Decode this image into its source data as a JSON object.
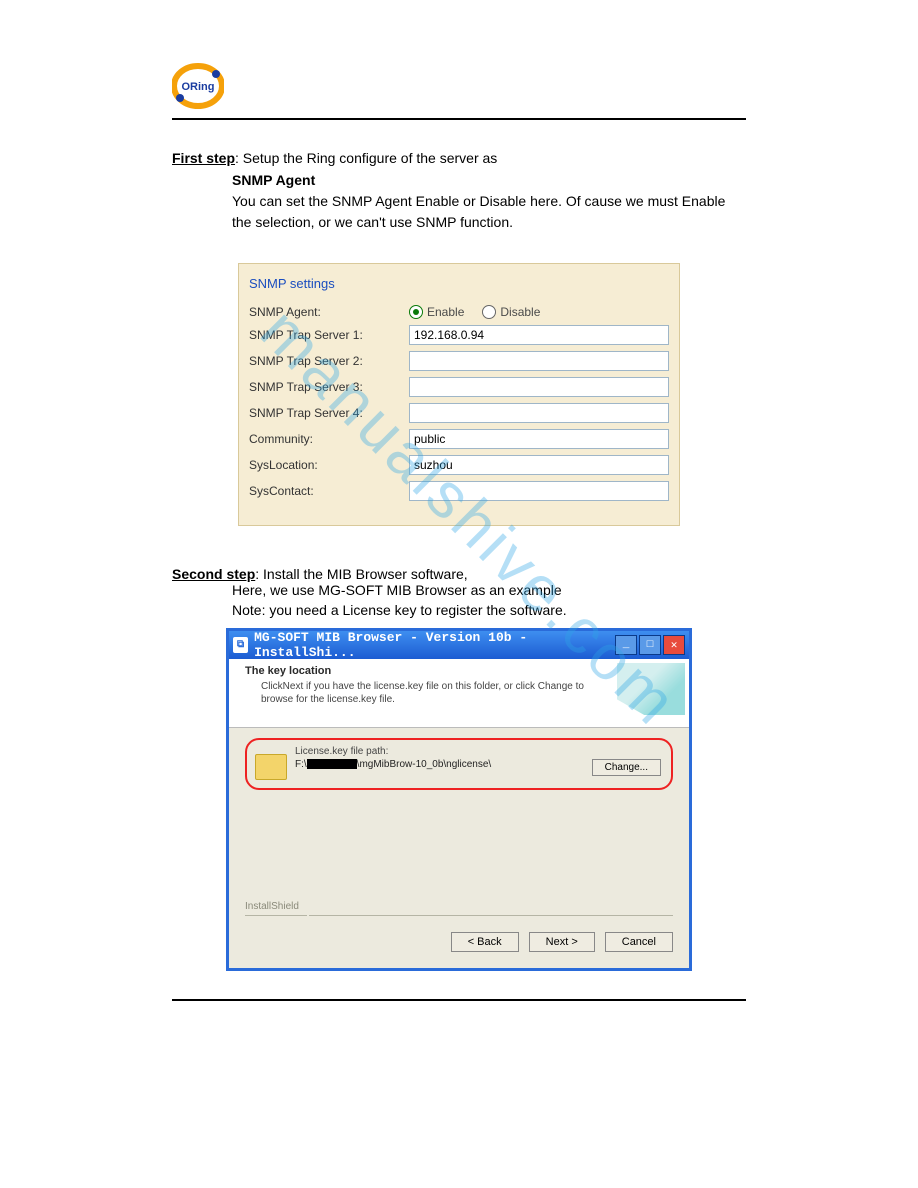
{
  "watermark": "manualshive.com",
  "step1": {
    "prefix_underlined": "First step",
    "rest": ": Setup the Ring configure of the server as",
    "body1": "SNMP Agent",
    "body2": "You can set the SNMP Agent Enable or Disable here. Of cause we must Enable the selection, or we can't use SNMP function."
  },
  "snmp": {
    "title": "SNMP settings",
    "labels": {
      "agent": "SNMP Agent:",
      "trap1": "SNMP Trap Server 1:",
      "trap2": "SNMP Trap Server 2:",
      "trap3": "SNMP Trap Server 3:",
      "trap4": "SNMP Trap Server 4:",
      "community": "Community:",
      "syslocation": "SysLocation:",
      "syscontact": "SysContact:"
    },
    "radio_enable": "Enable",
    "radio_disable": "Disable",
    "values": {
      "trap1": "192.168.0.94",
      "trap2": "",
      "trap3": "",
      "trap4": "",
      "community": "public",
      "syslocation": "suzhou",
      "syscontact": ""
    }
  },
  "step2": {
    "prefix_underlined": "Second step",
    "rest": ": Install the MIB Browser software,",
    "line2": "Here, we use MG-SOFT MIB Browser as an example",
    "line3": "Note: you need a License key to register the software."
  },
  "installer": {
    "title": "MG-SOFT MIB Browser - Version 10b  - InstallShi...",
    "banner_title": "The key location",
    "banner_sub": "ClickNext if you have the license.key file on this folder, or click Change to browse for the license.key file.",
    "lic_label": "License.key file path:",
    "lic_path_prefix": "F:\\",
    "lic_path_suffix": "\\mgMibBrow-10_0b\\nglicense\\",
    "change": "Change...",
    "ishield": "InstallShield",
    "back": "< Back",
    "next": "Next >",
    "cancel": "Cancel"
  }
}
